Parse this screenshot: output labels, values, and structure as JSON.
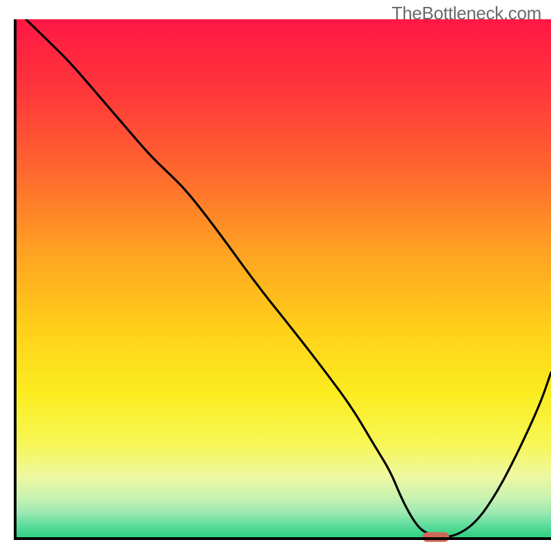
{
  "watermark": "TheBottleneck.com",
  "chart_data": {
    "type": "line",
    "title": "",
    "xlabel": "",
    "ylabel": "",
    "xlim": [
      0,
      100
    ],
    "ylim": [
      0,
      100
    ],
    "x": [
      2,
      5,
      10,
      15,
      20,
      25,
      28,
      32,
      38,
      45,
      52,
      58,
      63,
      67,
      70,
      72,
      74,
      76,
      79,
      82,
      86,
      90,
      94,
      98,
      100
    ],
    "y": [
      100,
      97,
      92,
      86,
      80,
      74,
      71,
      67,
      59,
      49,
      40,
      32,
      25,
      18,
      13,
      8,
      4,
      1.3,
      0.4,
      0.4,
      3,
      9,
      17,
      26,
      32
    ],
    "optimal_marker": {
      "x_start": 76,
      "x_end": 81,
      "y": 0.3,
      "color": "#cf675a"
    },
    "gradient_stops": [
      {
        "offset": 0.0,
        "color": "#ff1744"
      },
      {
        "offset": 0.15,
        "color": "#ff3a3a"
      },
      {
        "offset": 0.3,
        "color": "#ff6a2e"
      },
      {
        "offset": 0.45,
        "color": "#ffa322"
      },
      {
        "offset": 0.6,
        "color": "#ffd11a"
      },
      {
        "offset": 0.72,
        "color": "#fbec1f"
      },
      {
        "offset": 0.82,
        "color": "#f7f758"
      },
      {
        "offset": 0.88,
        "color": "#eef8a2"
      },
      {
        "offset": 0.92,
        "color": "#c9f3b0"
      },
      {
        "offset": 0.95,
        "color": "#9de9b2"
      },
      {
        "offset": 0.975,
        "color": "#5cdc9b"
      },
      {
        "offset": 1.0,
        "color": "#29d07f"
      }
    ],
    "axis_color": "#000000",
    "axis_thickness": 4
  }
}
